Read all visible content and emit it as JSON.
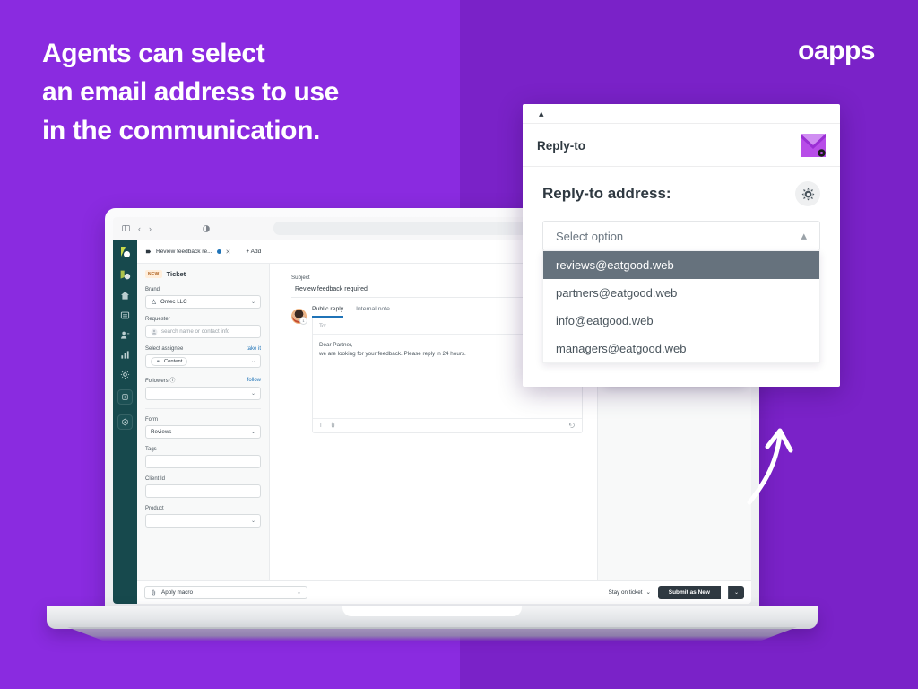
{
  "colors": {
    "bg_left": "#8a2be0",
    "bg_right": "#7a22c8",
    "accent_dark": "#2f3941",
    "option_selected_bg": "#66727d",
    "nav_rail": "#17494d"
  },
  "headline": {
    "line1": "Agents can select",
    "line2": "an email address to use",
    "line3": "in the communication."
  },
  "logo": {
    "text": "oapps"
  },
  "dialog": {
    "collapse_caret": "▴",
    "header_title": "Reply-to",
    "title": "Reply-to address:",
    "select_placeholder": "Select option",
    "select_caret": "▴",
    "options": [
      "reviews@eatgood.web",
      "partners@eatgood.web",
      "info@eatgood.web",
      "managers@eatgood.web"
    ],
    "selected_index": 0
  },
  "browser": {
    "tab_title": "Review feedback re...",
    "tab_close": "✕",
    "add_tab": "+ Add",
    "back": "‹",
    "forward": "›"
  },
  "ticket": {
    "badge_new": "NEW",
    "badge_label": "Ticket",
    "fields": {
      "brand_label": "Brand",
      "brand_value": "Ontec LLC",
      "requester_label": "Requester",
      "requester_placeholder": "search name or contact info",
      "assignee_label": "Select assignee",
      "assignee_action": "take it",
      "assignee_value": "Content",
      "followers_label": "Followers",
      "followers_info": "ⓘ",
      "followers_action": "follow",
      "followers_value": "",
      "form_label": "Form",
      "form_value": "Reviews",
      "tags_label": "Tags",
      "tags_value": "",
      "client_id_label": "Client Id",
      "client_id_value": "",
      "product_label": "Product",
      "product_value": ""
    },
    "subject_label": "Subject",
    "subject_value": "Review feedback required",
    "reply_tabs": [
      {
        "label": "Public reply",
        "active": true
      },
      {
        "label": "Internal note",
        "active": false
      }
    ],
    "to_placeholder": "To:",
    "body_line1": "Dear Partner,",
    "body_line2": "we are looking for your feedback. Please reply in 24 hours.",
    "editor_text_icon": "T",
    "footer": {
      "macro_placeholder": "Apply macro",
      "macro_caret": "⌄",
      "stay_label": "Stay on ticket",
      "stay_caret": "⌄",
      "submit_label": "Submit as New",
      "submit_caret": "⌄"
    }
  },
  "inset_dialog": {
    "collapse_caret": "▴",
    "header_title": "Reply-to",
    "title": "Reply-to address:",
    "select_placeholder": "Select option",
    "select_caret": "▴",
    "options": [
      "reviews@eatgood.web",
      "partners@eatgood.web",
      "info@eatgood.web",
      "managers@eatgood.web"
    ]
  }
}
